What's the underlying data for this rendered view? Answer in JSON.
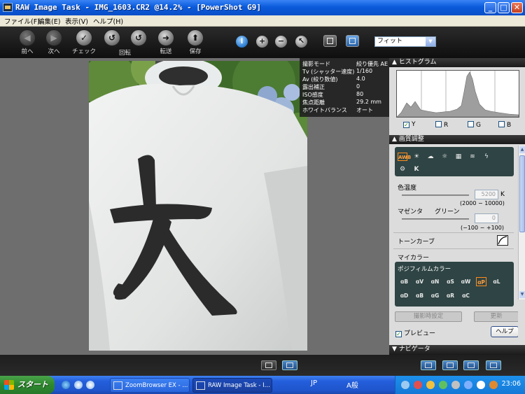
{
  "window": {
    "title": "RAW Image Task - IMG_1603.CR2 @14.2% - [PowerShot G9]",
    "min_label": "_",
    "max_label": "□",
    "close_label": "✕"
  },
  "menu": [
    "ファイル(F)",
    "編集(E)",
    "表示(V)",
    "ヘルプ(H)"
  ],
  "toolbar": {
    "prev": {
      "label": "前へ",
      "icon": "◀"
    },
    "next": {
      "label": "次へ",
      "icon": "▶"
    },
    "check": {
      "label": "チェック",
      "icon": "✓"
    },
    "rotate": {
      "label": "回転",
      "icon": "↺"
    },
    "transfer": {
      "label": "転送",
      "icon": "➜"
    },
    "save": {
      "label": "保存",
      "icon": "⬆"
    },
    "small": {
      "info": "i",
      "zoom_in": "+",
      "zoom_out": "−",
      "pointer": "↖"
    },
    "zoom_value": "フィット",
    "zoom_arrow": "▼"
  },
  "shooting_info": [
    {
      "k": "撮影モード",
      "v": "絞り優先 AE"
    },
    {
      "k": "Tv (シャッター速度)",
      "v": "1/160"
    },
    {
      "k": "Av (絞り数値)",
      "v": "4.0"
    },
    {
      "k": "露出補正",
      "v": "0"
    },
    {
      "k": "ISO感度",
      "v": "80"
    },
    {
      "k": "焦点距離",
      "v": "29.2 mm"
    },
    {
      "k": "ホワイトバランス",
      "v": "オート"
    }
  ],
  "panel": {
    "histogram_header": "▲ ヒストグラム",
    "histo_checks": [
      {
        "label": "Y",
        "checked": true
      },
      {
        "label": "R",
        "checked": false
      },
      {
        "label": "G",
        "checked": false
      },
      {
        "label": "B",
        "checked": false
      }
    ],
    "adjust_header": "▲ 画質調整",
    "wb_icons": [
      "AWB",
      "☀",
      "☁",
      "☼",
      "▦",
      "≋",
      "ϟ",
      "⚙",
      "K"
    ],
    "color_temp_label": "色温度",
    "color_temp_value": "5200",
    "color_temp_unit": "K",
    "color_temp_range": "(2000 − 10000)",
    "magenta_label": "マゼンタ",
    "green_label": "グリーン",
    "mg_value": "0",
    "mg_range": "(−100 − +100)",
    "tone_curve_label": "トーンカーブ",
    "my_color_label": "マイカラー",
    "positive_film_label": "ポジフィルムカラー",
    "mc_icons": [
      "ɑB",
      "ɑV",
      "ɑN",
      "ɑS",
      "ɑW",
      "ɑP",
      "ɑL",
      "ɑD",
      "ɑB",
      "ɑG",
      "ɑR",
      "ɑC"
    ],
    "shooting_settings_button": "撮影時設定",
    "update_button": "更新",
    "preview_label": "プレビュー",
    "help_button": "ヘルプ",
    "navigator_header": "▼ ナビゲータ"
  },
  "taskbar": {
    "start": "スタート",
    "tasks": [
      "ZoomBrowser EX - ...",
      "RAW Image Task - I..."
    ],
    "lang": "JP",
    "ime": "A般",
    "time": "23:06"
  },
  "colors": {
    "titlebar": "#0a5bdc",
    "panel_dark": "#2f4444",
    "selection_orange": "#ff8c1a"
  }
}
